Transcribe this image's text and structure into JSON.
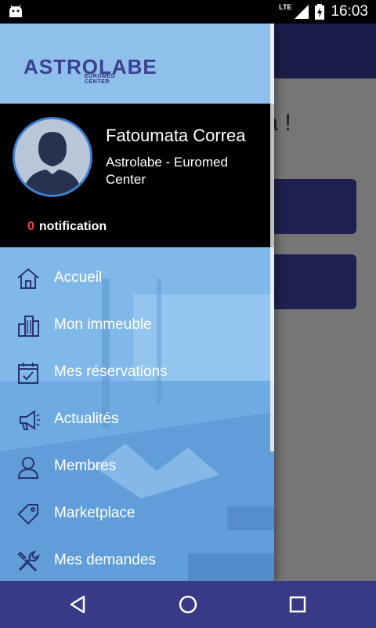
{
  "status_bar": {
    "network": "LTE",
    "time": "16:03",
    "icons": [
      "android-icon",
      "signal-icon",
      "battery-charging-icon"
    ]
  },
  "background_screen": {
    "greeting_partial": "ta !"
  },
  "drawer": {
    "logo": {
      "text": "ASTROLABE",
      "subtext": "EUROMED CENTER"
    },
    "profile": {
      "name": "Fatoumata Correa",
      "company": "Astrolabe - Euromed Center",
      "notification_count": "0",
      "notification_label": "notification"
    },
    "menu": [
      {
        "label": "Accueil",
        "icon": "home-icon"
      },
      {
        "label": "Mon immeuble",
        "icon": "building-icon"
      },
      {
        "label": "Mes réservations",
        "icon": "calendar-check-icon"
      },
      {
        "label": "Actualités",
        "icon": "megaphone-icon"
      },
      {
        "label": "Membres",
        "icon": "person-icon"
      },
      {
        "label": "Marketplace",
        "icon": "tag-icon"
      },
      {
        "label": "Mes demandes",
        "icon": "tools-icon"
      }
    ]
  },
  "nav_bar": {
    "buttons": [
      "back-icon",
      "home-circle-icon",
      "recents-icon"
    ]
  },
  "colors": {
    "drawer_logo_bg": "#8fc0ec",
    "profile_bg": "#000000",
    "menu_bg": "#6aa6dc",
    "notification_count": "#f0434a",
    "nav_bar": "#393a87",
    "app_topbar": "#1c1e4a"
  }
}
